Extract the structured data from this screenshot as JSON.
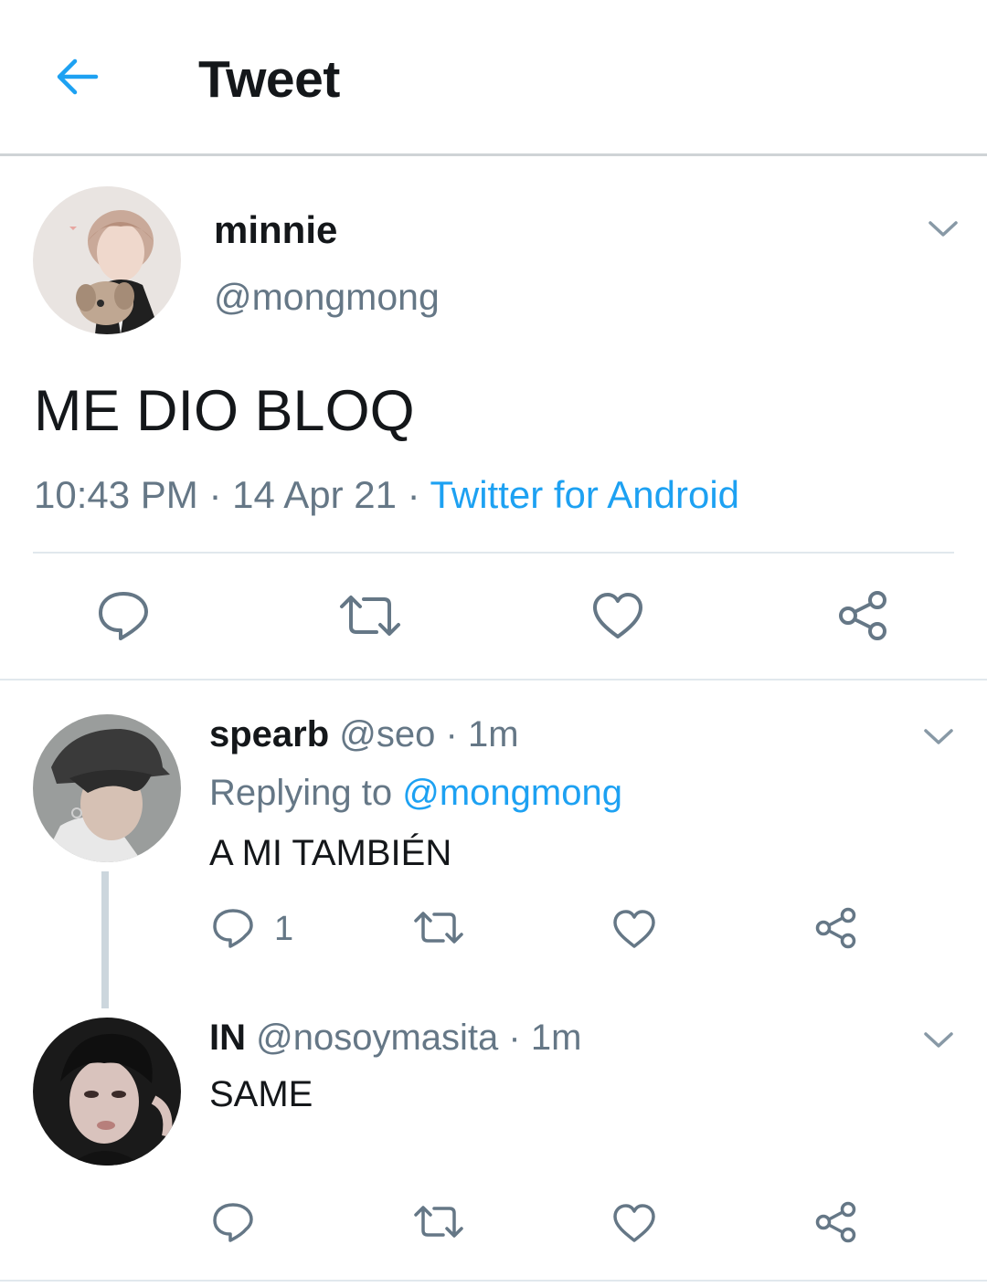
{
  "header": {
    "title": "Tweet",
    "back_icon": "arrow-left-icon",
    "accent": "#1da1f2"
  },
  "main_tweet": {
    "display_name": "minnie",
    "handle": "@mongmong",
    "text": "ME DIO BLOQ",
    "time": "10:43 PM",
    "date": "14 Apr 21",
    "separator": "·",
    "source": "Twitter for Android",
    "actions": [
      "reply-icon",
      "retweet-icon",
      "like-icon",
      "share-icon"
    ]
  },
  "replies": [
    {
      "display_name": "spearb",
      "handle": "@seo",
      "time": "1m",
      "separator": "·",
      "replying_prefix": "Replying to",
      "replying_to": "@mongmong",
      "text": "A MI TAMBIÉN",
      "reply_count": "1"
    },
    {
      "display_name": "IN",
      "handle": "@nosoymasita",
      "time": "1m",
      "separator": "·",
      "text": "SAME"
    }
  ],
  "colors": {
    "text": "#14171a",
    "muted": "#657786",
    "link": "#1da1f2",
    "divider": "#e1e8ed"
  }
}
